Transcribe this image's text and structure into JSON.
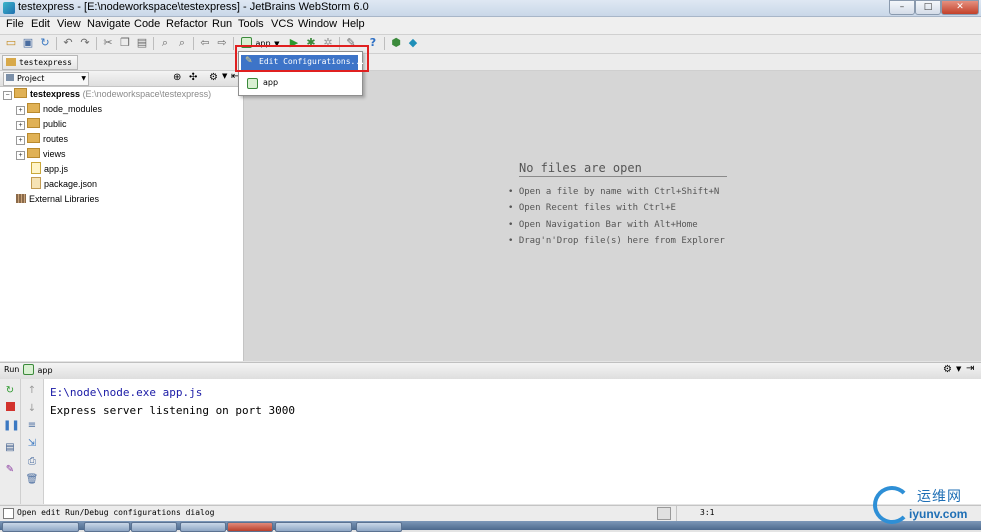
{
  "window": {
    "title": "testexpress - [E:\\nodeworkspace\\testexpress] - JetBrains WebStorm 6.0",
    "minimize": "–",
    "maximize": "□",
    "close": "✕"
  },
  "menu": [
    "File",
    "Edit",
    "View",
    "Navigate",
    "Code",
    "Refactor",
    "Run",
    "Tools",
    "VCS",
    "Window",
    "Help"
  ],
  "toolbar": {
    "run_config": "app",
    "icons": [
      "open-folder-icon",
      "save-icon",
      "sync-icon",
      "undo-icon",
      "redo-icon",
      "cut-icon",
      "copy-icon",
      "paste-icon",
      "find-icon",
      "replace-icon",
      "back-icon",
      "forward-icon",
      "run-icon",
      "debug-icon",
      "coverage-icon",
      "settings-icon",
      "help-icon",
      "nodejs-icon",
      "webstorm-icon"
    ]
  },
  "navbar": {
    "breadcrumb": "testexpress"
  },
  "project_panel": {
    "view_selector": "Project",
    "root": {
      "name": "testexpress",
      "path": "(E:\\nodeworkspace\\testexpress)"
    },
    "items": [
      {
        "name": "node_modules",
        "type": "folder"
      },
      {
        "name": "public",
        "type": "folder"
      },
      {
        "name": "routes",
        "type": "folder"
      },
      {
        "name": "views",
        "type": "folder"
      },
      {
        "name": "app.js",
        "type": "js"
      },
      {
        "name": "package.json",
        "type": "json"
      }
    ],
    "external": "External Libraries"
  },
  "dropdown": {
    "items": [
      "Edit Configurations...",
      "app"
    ]
  },
  "editor": {
    "empty_title": "No files are open",
    "tips": [
      "• Open a file by name with Ctrl+Shift+N",
      "• Open Recent files with Ctrl+E",
      "• Open Navigation Bar with Alt+Home",
      "• Drag'n'Drop file(s) here from Explorer"
    ]
  },
  "run_panel": {
    "label": "Run",
    "tab": "app",
    "console": [
      {
        "text": "E:\\node\\node.exe app.js",
        "color": "#1a1aa6"
      },
      {
        "text": "Express server listening on port 3000",
        "color": "#000000"
      }
    ]
  },
  "status": {
    "message": "Open edit Run/Debug configurations dialog",
    "position": "3:1"
  },
  "watermark": {
    "cn": "运维网",
    "en": "iyunv.com"
  },
  "colors": {
    "highlight": "#e02020",
    "selection": "#3d74c8",
    "editor_bg": "#d6d6d6"
  }
}
